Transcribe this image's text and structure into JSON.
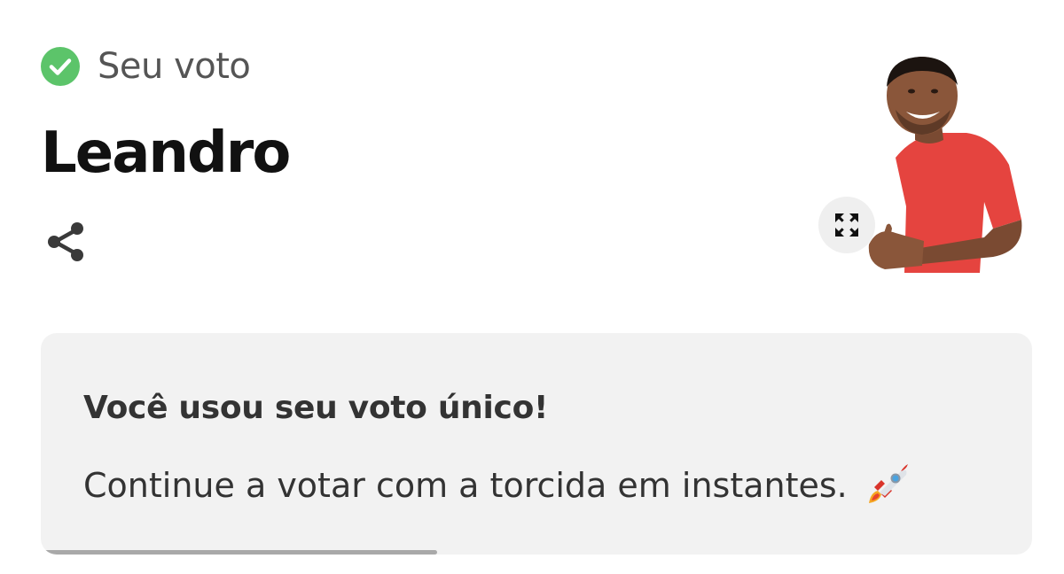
{
  "header": {
    "vote_label": "Seu voto",
    "check_color": "#5cc46a",
    "check_icon": "check-circle-icon"
  },
  "candidate": {
    "name": "Leandro",
    "photo_alt": "Leandro",
    "shirt_color": "#e53e3e"
  },
  "actions": {
    "share_icon": "share-icon",
    "expand_icon": "expand-icon"
  },
  "notice": {
    "title": "Você usou seu voto único!",
    "text": "Continue a votar com a torcida em instantes.",
    "emoji_icon": "rocket-icon",
    "progress": 0.4
  }
}
